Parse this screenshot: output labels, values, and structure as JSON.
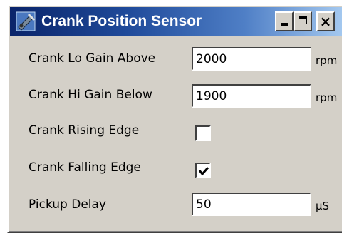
{
  "window": {
    "title": "Crank Position Sensor",
    "app_icon": "sensor-app-icon",
    "buttons": {
      "minimize_icon": "minimize-icon",
      "maximize_icon": "maximize-icon",
      "close_icon": "close-icon",
      "close_glyph": "×"
    }
  },
  "form": {
    "crank_lo_gain_above": {
      "label": "Crank Lo Gain Above",
      "value": "2000",
      "unit": "rpm"
    },
    "crank_hi_gain_below": {
      "label": "Crank Hi Gain Below",
      "value": "1900",
      "unit": "rpm"
    },
    "crank_rising_edge": {
      "label": "Crank Rising Edge",
      "checked": false
    },
    "crank_falling_edge": {
      "label": "Crank Falling Edge",
      "checked": true
    },
    "pickup_delay": {
      "label": "Pickup Delay",
      "value": "50",
      "unit": "µS"
    }
  },
  "colors": {
    "titlebar_start": "#0a246a",
    "titlebar_end": "#a6caf0",
    "window_face": "#d4d0c8"
  }
}
